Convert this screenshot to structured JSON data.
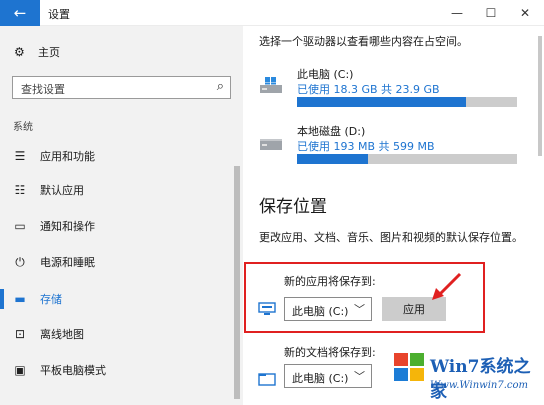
{
  "window": {
    "title": "设置",
    "back": "←",
    "minimize": "—",
    "maximize": "☐",
    "close": "✕"
  },
  "sidebar": {
    "home": "主页",
    "search_placeholder": "查找设置",
    "section": "系统",
    "items": [
      {
        "label": "应用和功能",
        "icon": "list-icon"
      },
      {
        "label": "默认应用",
        "icon": "default-apps-icon"
      },
      {
        "label": "通知和操作",
        "icon": "notification-icon"
      },
      {
        "label": "电源和睡眠",
        "icon": "power-icon"
      },
      {
        "label": "存储",
        "icon": "storage-icon",
        "active": true
      },
      {
        "label": "离线地图",
        "icon": "map-icon"
      },
      {
        "label": "平板电脑模式",
        "icon": "tablet-icon"
      }
    ]
  },
  "main": {
    "select_drive_text": "选择一个驱动器以查看哪些内容在占空间。",
    "drives": [
      {
        "name": "此电脑 (C:)",
        "usage": "已使用 18.3 GB 共 23.9 GB",
        "used_fraction": 0.766
      },
      {
        "name": "本地磁盘 (D:)",
        "usage": "已使用 193 MB 共 599 MB",
        "used_fraction": 0.322
      }
    ],
    "save_heading": "保存位置",
    "save_desc": "更改应用、文档、音乐、图片和视频的默认保存位置。",
    "new_apps_label": "新的应用将保存到:",
    "new_apps_value": "此电脑 (C:)",
    "apply_label": "应用",
    "new_docs_label": "新的文档将保存到:",
    "new_docs_value": "此电脑 (C:)"
  },
  "watermark": {
    "brand": "Win7系统之家",
    "url": "Www.Winwin7.com"
  },
  "colors": {
    "accent": "#1e74d0",
    "highlight": "#e02020"
  }
}
